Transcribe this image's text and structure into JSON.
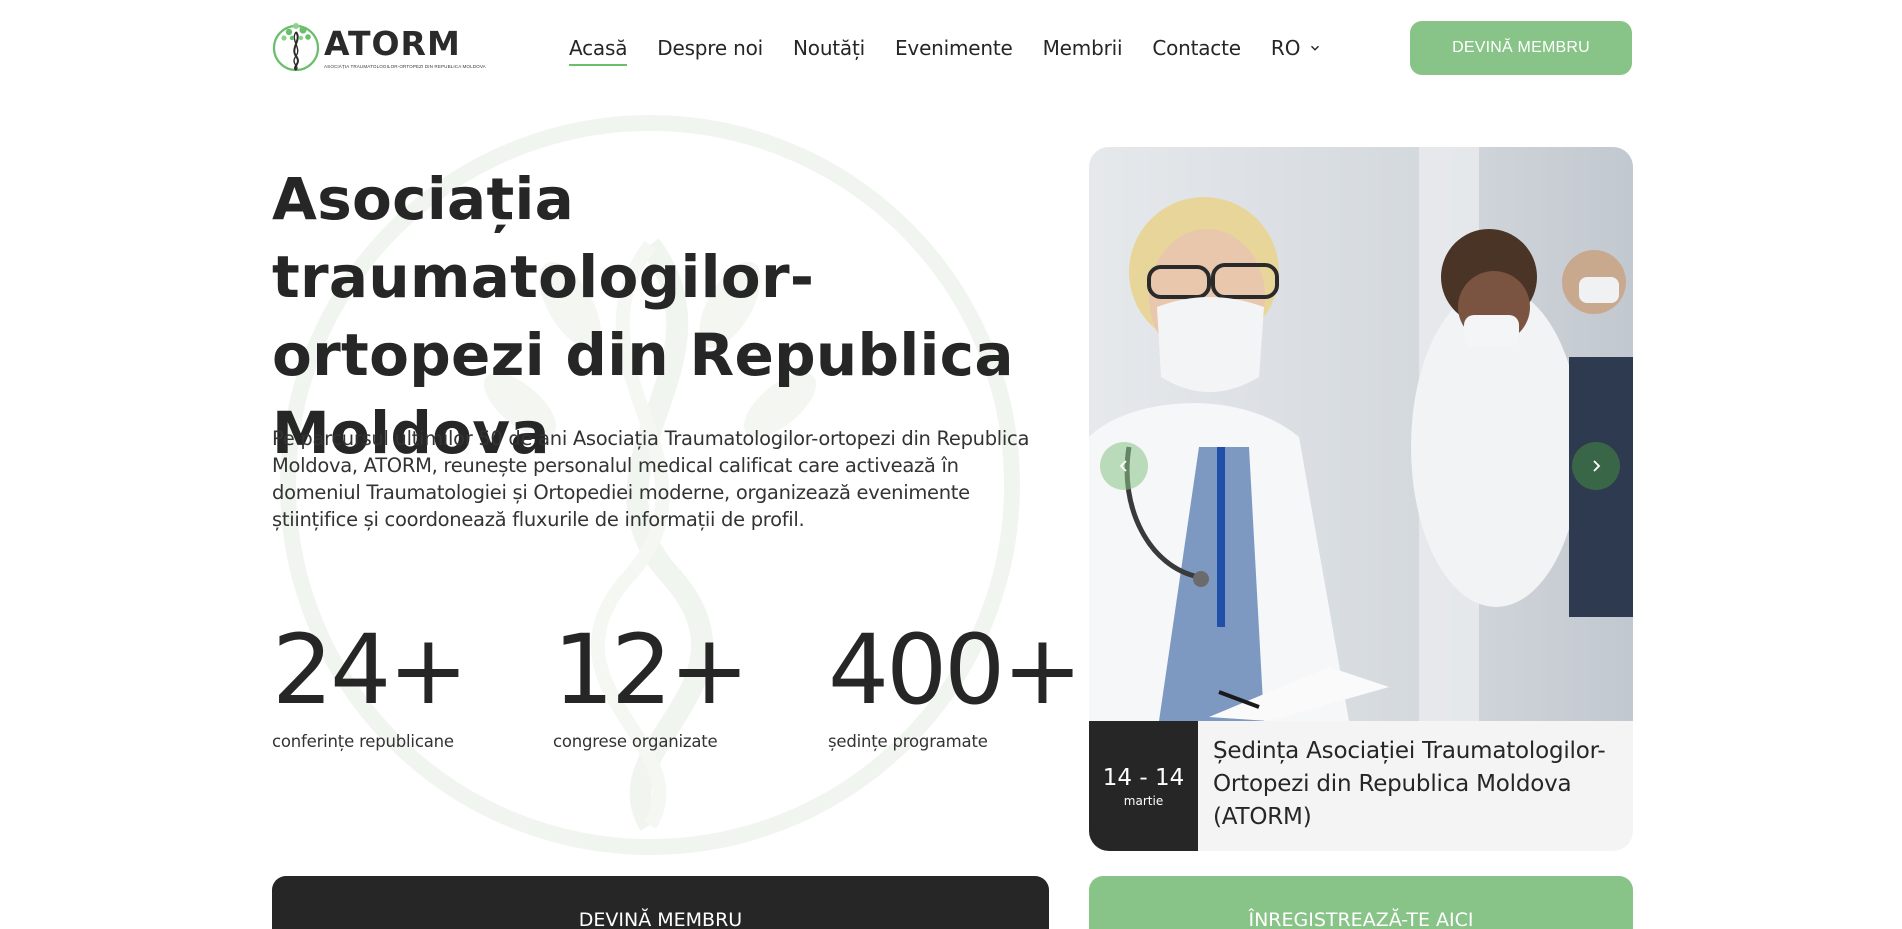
{
  "header": {
    "logo_title": "ATORM",
    "logo_subtitle": "ASOCIAȚIA TRAUMATOLOGILOR-ORTOPEZI DIN REPUBLICA MOLDOVA",
    "nav": {
      "home": "Acasă",
      "about": "Despre noi",
      "news": "Noutăți",
      "events": "Evenimente",
      "members": "Membrii",
      "contacts": "Contacte"
    },
    "language": "RO",
    "cta": "DEVINĂ MEMBRU"
  },
  "hero": {
    "title": "Asociația traumatologilor-ortopezi din Republica Moldova",
    "description": "Pe parcursul ultimilor 50 de ani Asociația Traumatologilor-ortopezi din Republica Moldova, ATORM, reunește personalul medical calificat care activează în domeniul Traumatologiei și Ortopediei moderne, organizează evenimente științifice și coordonează fluxurile de informații de profil."
  },
  "stats": [
    {
      "value": "24+",
      "label": "conferințe republicane"
    },
    {
      "value": "12+",
      "label": "congrese organizate"
    },
    {
      "value": "400+",
      "label": "ședințe programate"
    }
  ],
  "event": {
    "date_range": "14 - 14",
    "month": "martie",
    "title": "Ședința Asociației Traumatologilor-Ortopezi din Republica Moldova (ATORM)"
  },
  "buttons": {
    "become_member": "DEVINĂ MEMBRU",
    "register": "ÎNREGISTREAZĂ-TE AICI"
  },
  "icons": {
    "lang_dropdown": "chevron-down-icon",
    "slider_prev": "chevron-left-icon",
    "slider_next": "chevron-right-icon"
  },
  "colors": {
    "accent_green": "#88c487",
    "dark": "#262626",
    "nav_underline": "#6bbf6c"
  }
}
